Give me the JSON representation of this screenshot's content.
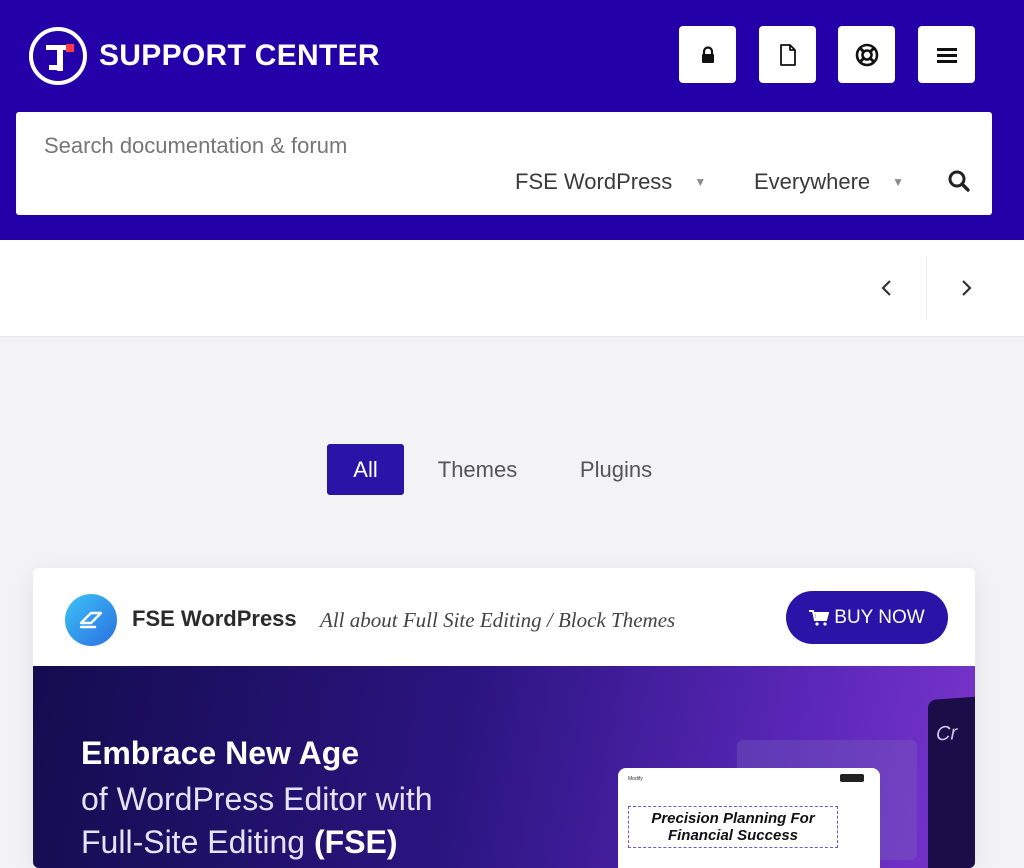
{
  "header": {
    "brand": "SUPPORT CENTER",
    "icons": [
      "lock-icon",
      "document-icon",
      "lifebuoy-icon",
      "menu-icon"
    ],
    "accent_color": "#2300a8"
  },
  "search": {
    "placeholder": "Search documentation & forum",
    "product_filter": "FSE WordPress",
    "scope_filter": "Everywhere"
  },
  "filters": {
    "items": [
      "All",
      "Themes",
      "Plugins"
    ],
    "active": "All"
  },
  "product_card": {
    "name": "FSE WordPress",
    "tagline": "All about Full Site Editing / Block Themes",
    "buy_label": "BUY NOW",
    "banner": {
      "line1": "Embrace New Age",
      "line2": "of WordPress Editor with",
      "line3_prefix": "Full-Site Editing ",
      "line3_accent": "(FSE)",
      "mock_brand": "Modify",
      "mock_heading_line1": "Precision Planning For",
      "mock_heading_line2": "Financial Success",
      "side_text": "Cr"
    }
  }
}
